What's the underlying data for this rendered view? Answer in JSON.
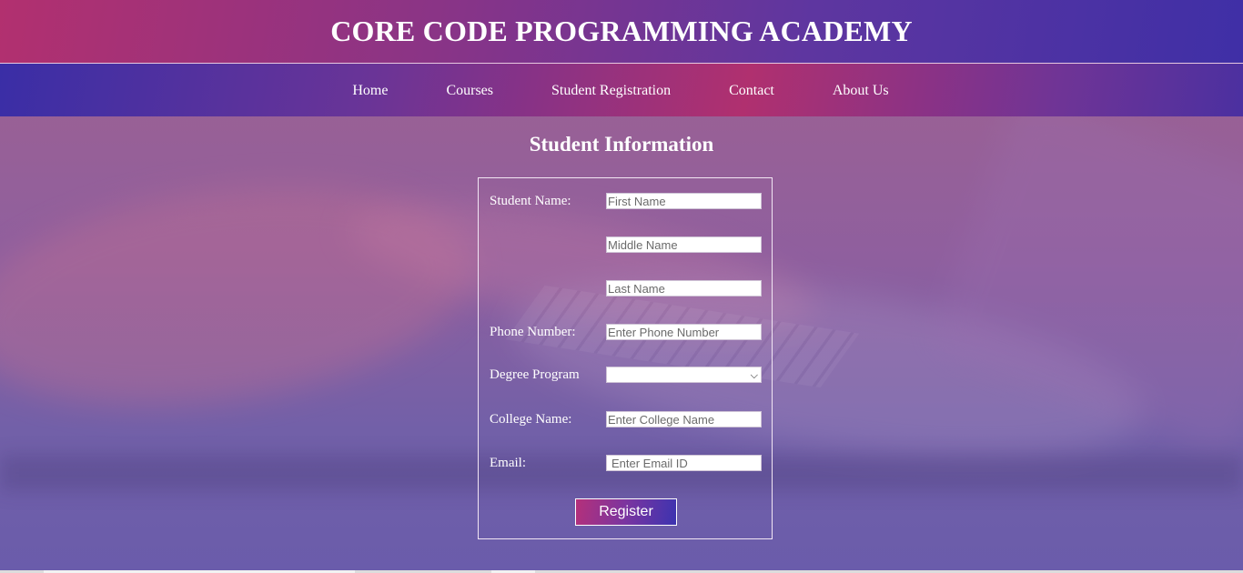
{
  "header": {
    "title": "CORE CODE PROGRAMMING ACADEMY"
  },
  "nav": {
    "items": [
      {
        "label": "Home"
      },
      {
        "label": "Courses"
      },
      {
        "label": "Student Registration"
      },
      {
        "label": "Contact"
      },
      {
        "label": "About Us"
      }
    ]
  },
  "form": {
    "title": "Student Information",
    "student_name_label": "Student Name:",
    "first_name_placeholder": "First Name",
    "middle_name_placeholder": "Middle Name",
    "last_name_placeholder": "Last Name",
    "phone_label": "Phone Number:",
    "phone_placeholder": "Enter Phone Number",
    "degree_label": "Degree Program",
    "degree_selected": "",
    "college_label": "College Name:",
    "college_placeholder": "Enter College Name",
    "email_label": "Email:",
    "email_placeholder": "Enter Email ID",
    "register_label": "Register"
  },
  "colors": {
    "header_gradient": [
      "#b2306f",
      "#3f2fa6"
    ],
    "nav_gradient": [
      "#3a2ea6",
      "#b0306f"
    ],
    "page_overlay": "#8f5f9e"
  }
}
